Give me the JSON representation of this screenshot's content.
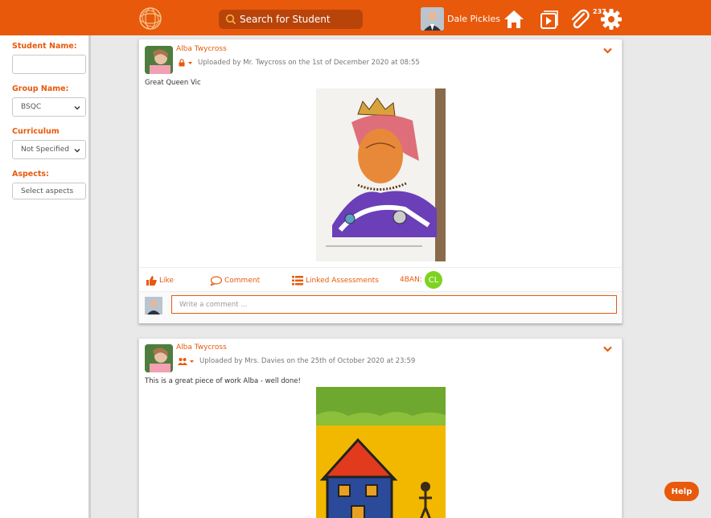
{
  "header": {
    "search_label": "Search for Student",
    "user_name": "Dale Pickles",
    "notification_count": "237",
    "icons": [
      "logo-icon",
      "home-icon",
      "media-icon",
      "paperclip-icon",
      "settings-icon"
    ]
  },
  "filters": {
    "student_name_label": "Student Name:",
    "student_name_value": "",
    "group_name_label": "Group Name:",
    "group_name_value": "BSQC",
    "curriculum_label": "Curriculum",
    "curriculum_value": "Not Specified",
    "aspects_label": "Aspects:",
    "aspects_placeholder": "Select aspects"
  },
  "posts": [
    {
      "author": "Alba Twycross",
      "meta": "Uploaded by Mr. Twycross on the 1st of December 2020 at 08:55",
      "visibility_icon": "lock-icon",
      "caption": "Great Queen Vic",
      "actions": {
        "like": "Like",
        "comment": "Comment",
        "linked": "Linked Assessments",
        "tag_label": "4BAN:",
        "tag_initials": "CL"
      },
      "comment_placeholder": "Write a comment ..."
    },
    {
      "author": "Alba Twycross",
      "meta": "Uploaded by Mrs. Davies on the 25th of October 2020 at 23:59",
      "visibility_icon": "group-icon",
      "caption": "This is a great piece of work Alba - well done!"
    }
  ],
  "help_label": "Help",
  "colors": {
    "accent": "#e8590c",
    "tag_green": "#7ed321"
  }
}
